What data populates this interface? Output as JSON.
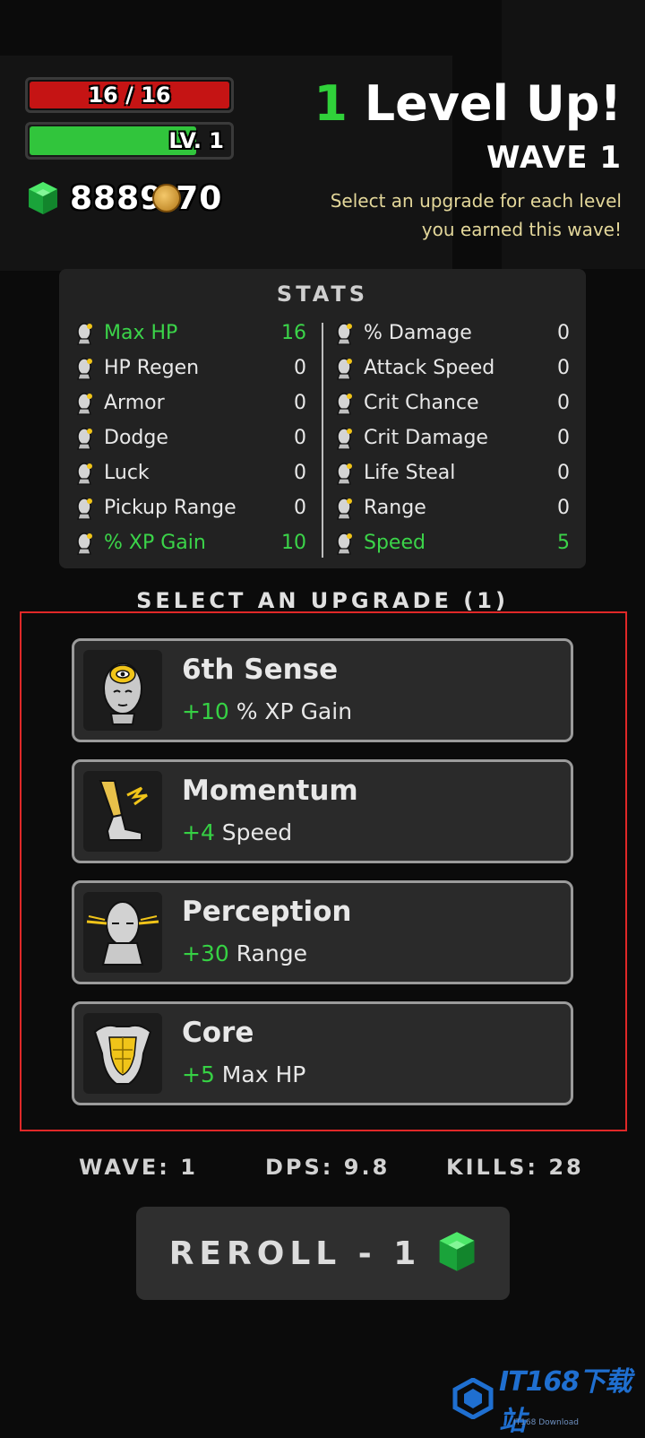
{
  "hud": {
    "hp_text": "16 / 16",
    "xp_fill": 0.82,
    "level_text": "LV. 1",
    "gems_left": "8889",
    "gems_right": "70"
  },
  "header": {
    "level_up_count": "1",
    "level_up_label": "Level Up!",
    "wave_title": "WAVE 1",
    "subtitle": "Select an upgrade for each level you earned this wave!"
  },
  "stats": {
    "title": "STATS",
    "left": [
      {
        "label": "Max HP",
        "value": "16",
        "highlight": true,
        "icon": "bust-icon"
      },
      {
        "label": "HP Regen",
        "value": "0",
        "highlight": false,
        "icon": "regen-icon"
      },
      {
        "label": "Armor",
        "value": "0",
        "highlight": false,
        "icon": "armor-icon"
      },
      {
        "label": "Dodge",
        "value": "0",
        "highlight": false,
        "icon": "dodge-icon"
      },
      {
        "label": "Luck",
        "value": "0",
        "highlight": false,
        "icon": "luck-icon"
      },
      {
        "label": "Pickup Range",
        "value": "0",
        "highlight": false,
        "icon": "pickup-icon"
      },
      {
        "label": "% XP Gain",
        "value": "10",
        "highlight": true,
        "icon": "xp-icon"
      }
    ],
    "right": [
      {
        "label": "% Damage",
        "value": "0",
        "highlight": false,
        "icon": "damage-icon"
      },
      {
        "label": "Attack Speed",
        "value": "0",
        "highlight": false,
        "icon": "attack-speed-icon"
      },
      {
        "label": "Crit Chance",
        "value": "0",
        "highlight": false,
        "icon": "crit-chance-icon"
      },
      {
        "label": "Crit Damage",
        "value": "0",
        "highlight": false,
        "icon": "crit-damage-icon"
      },
      {
        "label": "Life Steal",
        "value": "0",
        "highlight": false,
        "icon": "life-steal-icon"
      },
      {
        "label": "Range",
        "value": "0",
        "highlight": false,
        "icon": "range-icon"
      },
      {
        "label": "Speed",
        "value": "5",
        "highlight": true,
        "icon": "speed-icon"
      }
    ]
  },
  "upgrades": {
    "title": "SELECT AN UPGRADE (1)",
    "cards": [
      {
        "name": "6th Sense",
        "amount": "+10",
        "stat": " % XP Gain",
        "icon": "third-eye-icon"
      },
      {
        "name": "Momentum",
        "amount": "+4",
        "stat": " Speed",
        "icon": "winged-leg-icon"
      },
      {
        "name": "Perception",
        "amount": "+30",
        "stat": " Range",
        "icon": "perception-head-icon"
      },
      {
        "name": "Core",
        "amount": "+5",
        "stat": " Max HP",
        "icon": "torso-icon"
      }
    ]
  },
  "footer": {
    "wave": "WAVE: 1",
    "dps": "DPS: 9.8",
    "kills": "KILLS: 28",
    "reroll": "REROLL - 1"
  },
  "watermark": {
    "text": "IT168下载站",
    "sub": "IT168 Download"
  },
  "colors": {
    "accent_green": "#31c53c",
    "hp_red": "#c51414",
    "highlight_frame": "#e02828"
  }
}
